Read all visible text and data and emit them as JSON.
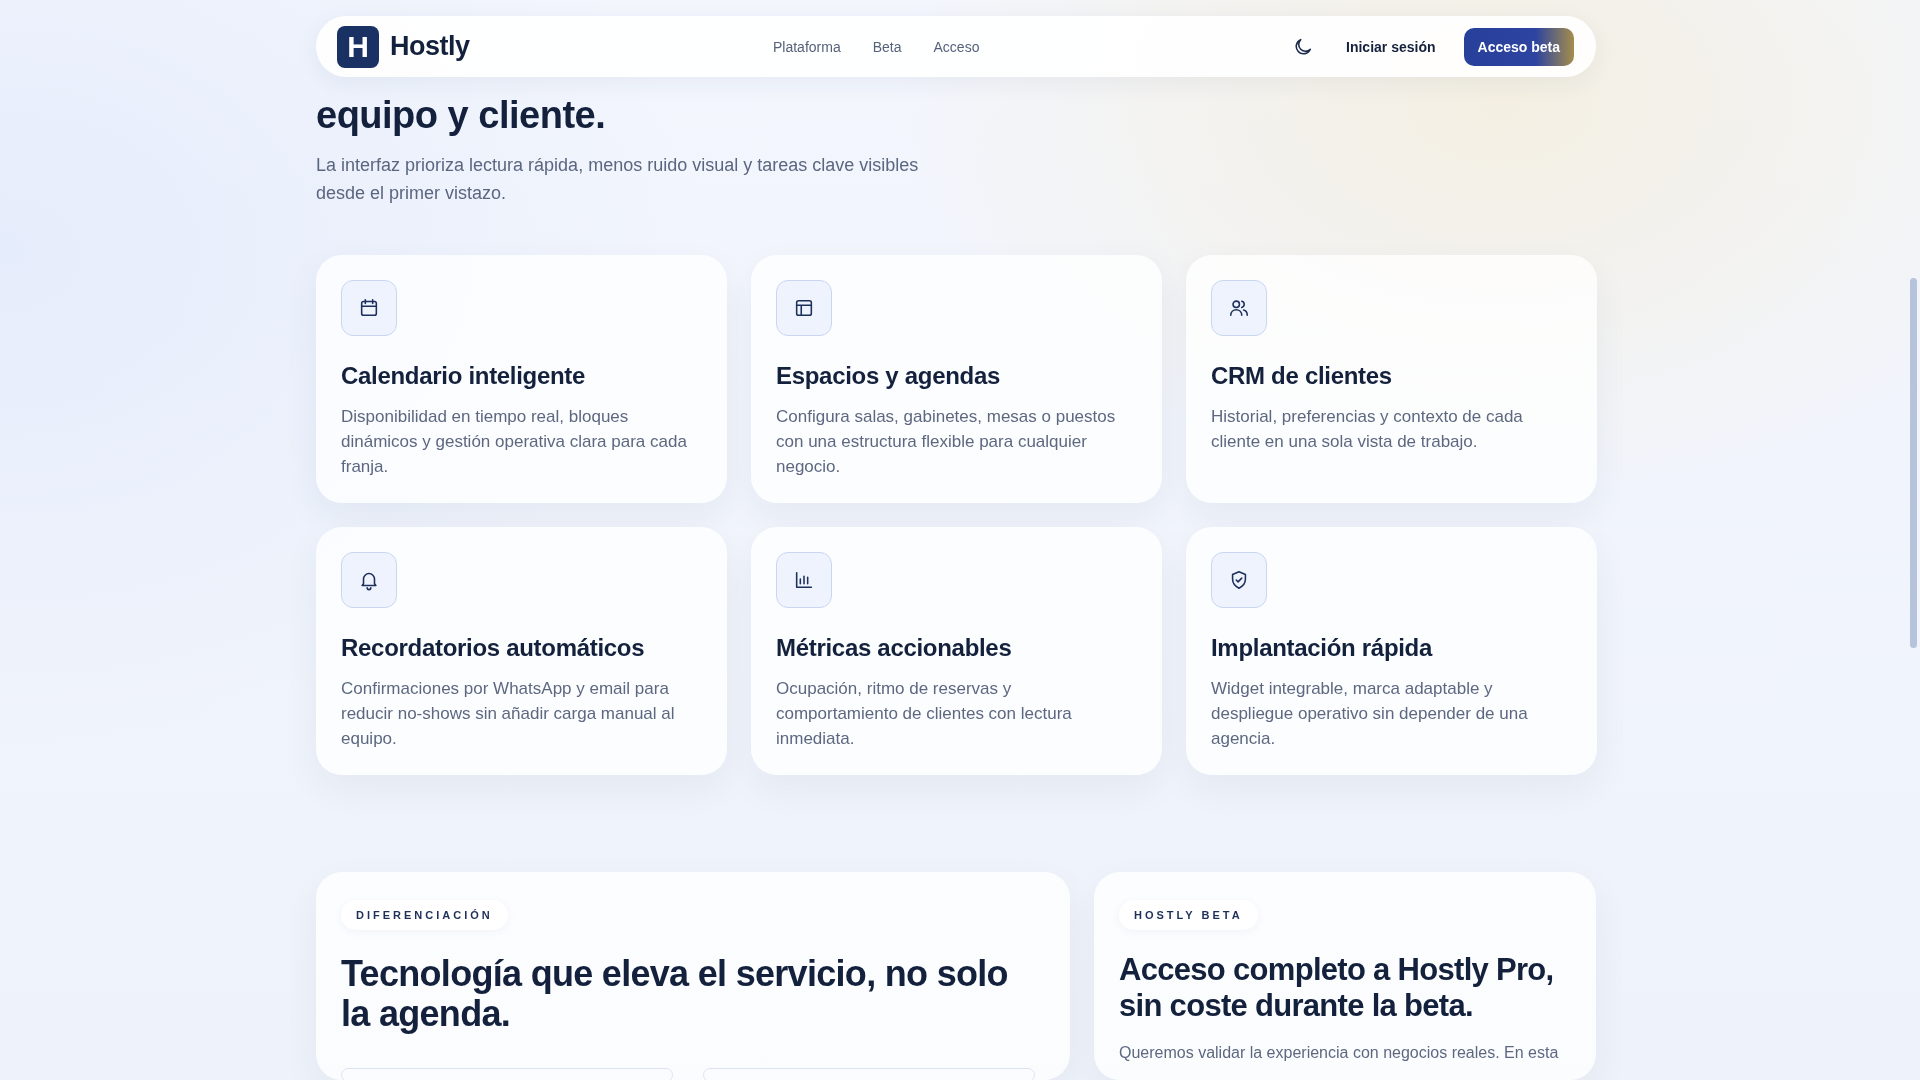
{
  "nav": {
    "brand_mark": "H",
    "brand": "Hostly",
    "links": [
      {
        "label": "Plataforma"
      },
      {
        "label": "Beta"
      },
      {
        "label": "Acceso"
      }
    ],
    "login": "Iniciar sesión",
    "cta": "Acceso beta"
  },
  "hero": {
    "title": "equipo y cliente.",
    "subtitle": "La interfaz prioriza lectura rápida, menos ruido visual y tareas clave visibles desde el primer vistazo."
  },
  "features": [
    {
      "kind": "calendar",
      "title": "Calendario inteligente",
      "text": "Disponibilidad en tiempo real, bloques dinámicos y gestión operativa clara para cada franja."
    },
    {
      "kind": "layout",
      "title": "Espacios y agendas",
      "text": "Configura salas, gabinetes, mesas o puestos con una estructura flexible para cualquier negocio."
    },
    {
      "kind": "users",
      "title": "CRM de clientes",
      "text": "Historial, preferencias y contexto de cada cliente en una sola vista de trabajo."
    },
    {
      "kind": "bell",
      "title": "Recordatorios automáticos",
      "text": "Confirmaciones por WhatsApp y email para reducir no-shows sin añadir carga manual al equipo."
    },
    {
      "kind": "chart",
      "title": "Métricas accionables",
      "text": "Ocupación, ritmo de reservas y comportamiento de clientes con lectura inmediata."
    },
    {
      "kind": "shield",
      "title": "Implantación rápida",
      "text": "Widget integrable, marca adaptable y despliegue operativo sin depender de una agencia."
    }
  ],
  "panels": [
    {
      "kind": "tiles",
      "badge": "DIFERENCIACIÓN",
      "title": "Tecnología que eleva el servicio, no solo la agenda."
    },
    {
      "kind": "text",
      "badge": "HOSTLY BETA",
      "title": "Acceso completo a Hostly Pro, sin coste durante la beta.",
      "text": "Queremos validar la experiencia con negocios reales. En esta"
    }
  ]
}
